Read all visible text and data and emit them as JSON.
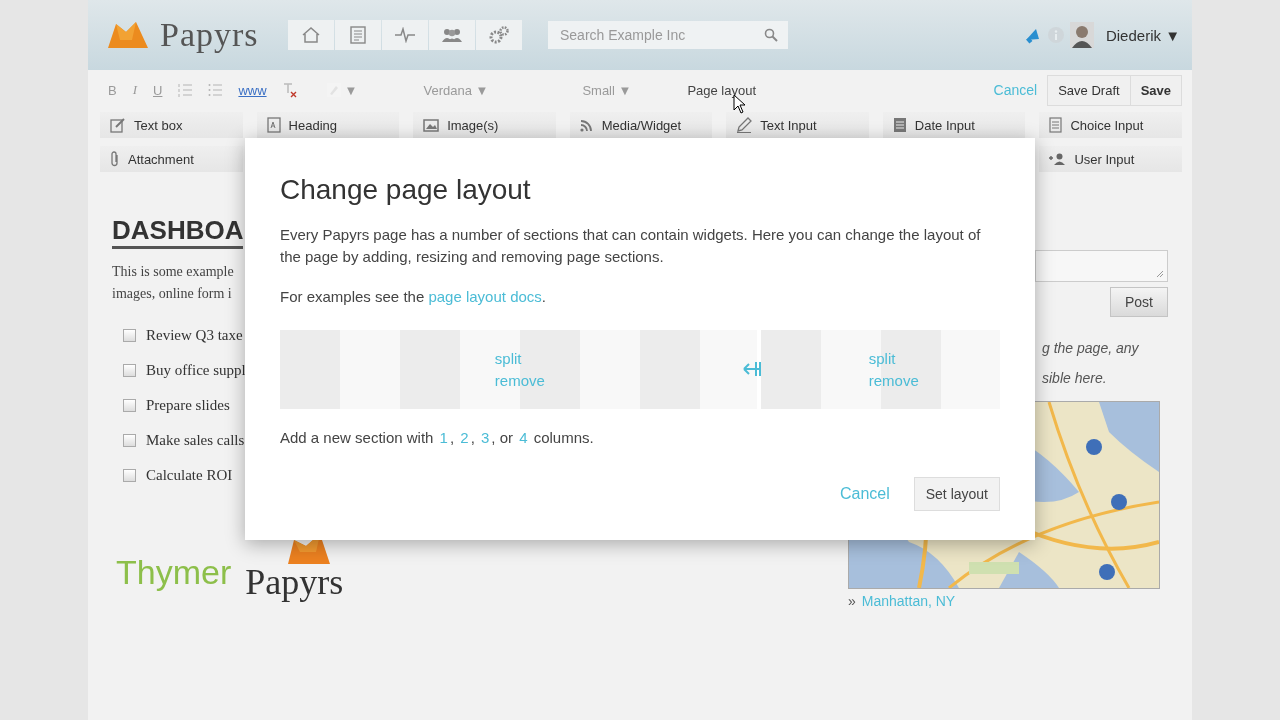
{
  "header": {
    "logo": "Papyrs",
    "search": {
      "placeholder": "Search Example Inc"
    },
    "user": "Diederik ▼"
  },
  "format_toolbar": {
    "disabled": true,
    "buttons": [
      "B",
      "I",
      "U"
    ],
    "link": "www",
    "color_caret": "▼",
    "font": "Verdana ▼",
    "size": "Small ▼",
    "page_layout": "Page layout",
    "cancel": "Cancel",
    "save_draft": "Save Draft",
    "save": "Save"
  },
  "widgets": [
    {
      "label": "Text box"
    },
    {
      "label": "Heading"
    },
    {
      "label": "Image(s)"
    },
    {
      "label": "Media/Widget"
    },
    {
      "label": "Text Input"
    },
    {
      "label": "Date Input"
    },
    {
      "label": "Choice Input"
    }
  ],
  "widgets_row2": [
    {
      "label": "Attachment"
    },
    {
      "label": "User Input"
    }
  ],
  "page": {
    "heading": "DASHBOA",
    "intro": [
      "This is some example",
      "images, online form i"
    ],
    "checklist": [
      {
        "label": "Review Q3 taxe",
        "checked": false
      },
      {
        "label": "Buy office suppl",
        "checked": false
      },
      {
        "label": "Prepare slides",
        "checked": false
      },
      {
        "label": "Make sales calls",
        "checked": false
      },
      {
        "label": "Calculate ROI",
        "checked": false
      }
    ],
    "footer_logos": [
      "Thymer",
      "Papyrs"
    ]
  },
  "sidebar": {
    "post_button": "Post",
    "note": [
      "g the page, any",
      "sible here."
    ],
    "map": {
      "kind": "picture"
    },
    "location_marker": "»",
    "location": "Manhattan, NY"
  },
  "dialog": {
    "title": "Change page layout",
    "description": "Every Papyrs page has a number of sections that can contain widgets. Here you can change the layout of the page by adding, resizing and removing page sections.",
    "examples": [
      {
        "text": "For examples see the "
      },
      {
        "link": "page layout docs"
      },
      {
        "text": "."
      }
    ],
    "sections": [
      {
        "split": "split",
        "remove": "remove"
      },
      {
        "split": "split",
        "remove": "remove"
      }
    ],
    "add_section": [
      {
        "text": "Add a new section with "
      },
      {
        "link": "1"
      },
      {
        "text": ", "
      },
      {
        "link": "2"
      },
      {
        "text": ", "
      },
      {
        "link": "3"
      },
      {
        "text": ", or "
      },
      {
        "link": "4"
      },
      {
        "text": " columns."
      }
    ],
    "cancel": "Cancel",
    "confirm": "Set layout"
  }
}
